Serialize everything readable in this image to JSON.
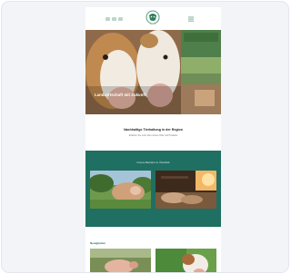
{
  "header": {
    "logo_icon": "cow-farm-logo-icon",
    "menu_icon": "hamburger-menu-icon",
    "accent": "#1f6f62"
  },
  "hero": {
    "caption": "Landwirtschaft mit Zukunft"
  },
  "intro": {
    "title": "Nachhaltige Tierhaltung in der Region",
    "subtitle": "Erfahren Sie mehr über unsere Höfe und Produkte"
  },
  "band": {
    "title": "Unsere Betriebe im Überblick",
    "color": "#1f6f62"
  },
  "bottom": {
    "title": "Neuigkeiten"
  }
}
